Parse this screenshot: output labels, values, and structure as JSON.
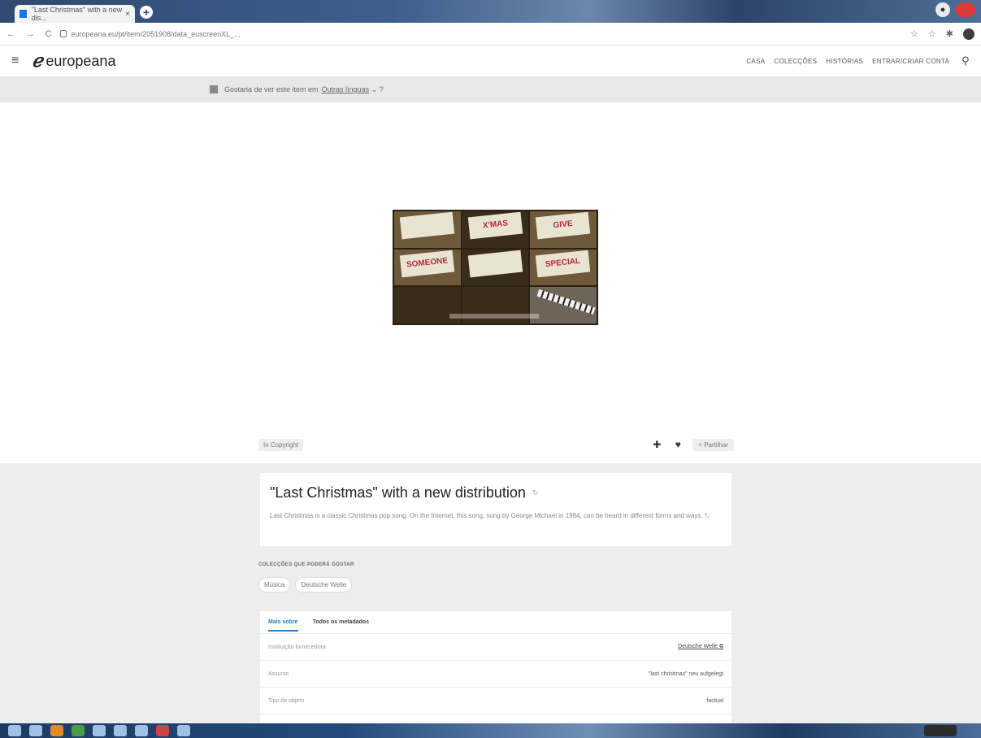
{
  "browser": {
    "tab_title": "\"Last Christmas\" with a new dis...",
    "tab_close": "×",
    "newtab_glyph": "+",
    "nav_icons": [
      "←",
      "→",
      "C"
    ],
    "url": "europeana.eu/pt/item/2051908/data_euscreenXL_...",
    "right_icons": [
      "☆",
      "☆",
      "✱"
    ]
  },
  "header": {
    "logo_text": "europeana",
    "nav": [
      "CASA",
      "COLECÇÕES",
      "HISTÓRIAS",
      "ENTRAR/CRIAR CONTA"
    ]
  },
  "language_banner": {
    "text": "Gostaria de ver este item em",
    "link": "Outras línguas",
    "suffix": "?"
  },
  "video": {
    "cards": [
      "",
      "X'MAS",
      "GIVE",
      "SOMEONE",
      "",
      "SPECIAL",
      "",
      "",
      ""
    ]
  },
  "viewer_bar": {
    "rights": "In Copyright",
    "share": "Partilhar"
  },
  "item": {
    "title": "\"Last Christmas\" with a new distribution",
    "description": "Last Christmas is a classic Christmas pop song. On the Internet, this song, sung by George Michael in 1984, can be heard in different forms and ways."
  },
  "collections": {
    "heading": "COLECÇÕES QUE PODERÁ GOSTAR",
    "chips": [
      "Música",
      "Deutsche Welle"
    ]
  },
  "metadata": {
    "tabs": [
      "Mais sobre",
      "Todos os metadados"
    ],
    "rows": [
      {
        "label": "Instituição fornecedora",
        "value": "Deutsche Welle"
      },
      {
        "label": "Assunto",
        "value": "\"last christmas\" neu aufgelegt"
      },
      {
        "label": "Tipo de objeto",
        "value": "factual"
      }
    ]
  }
}
